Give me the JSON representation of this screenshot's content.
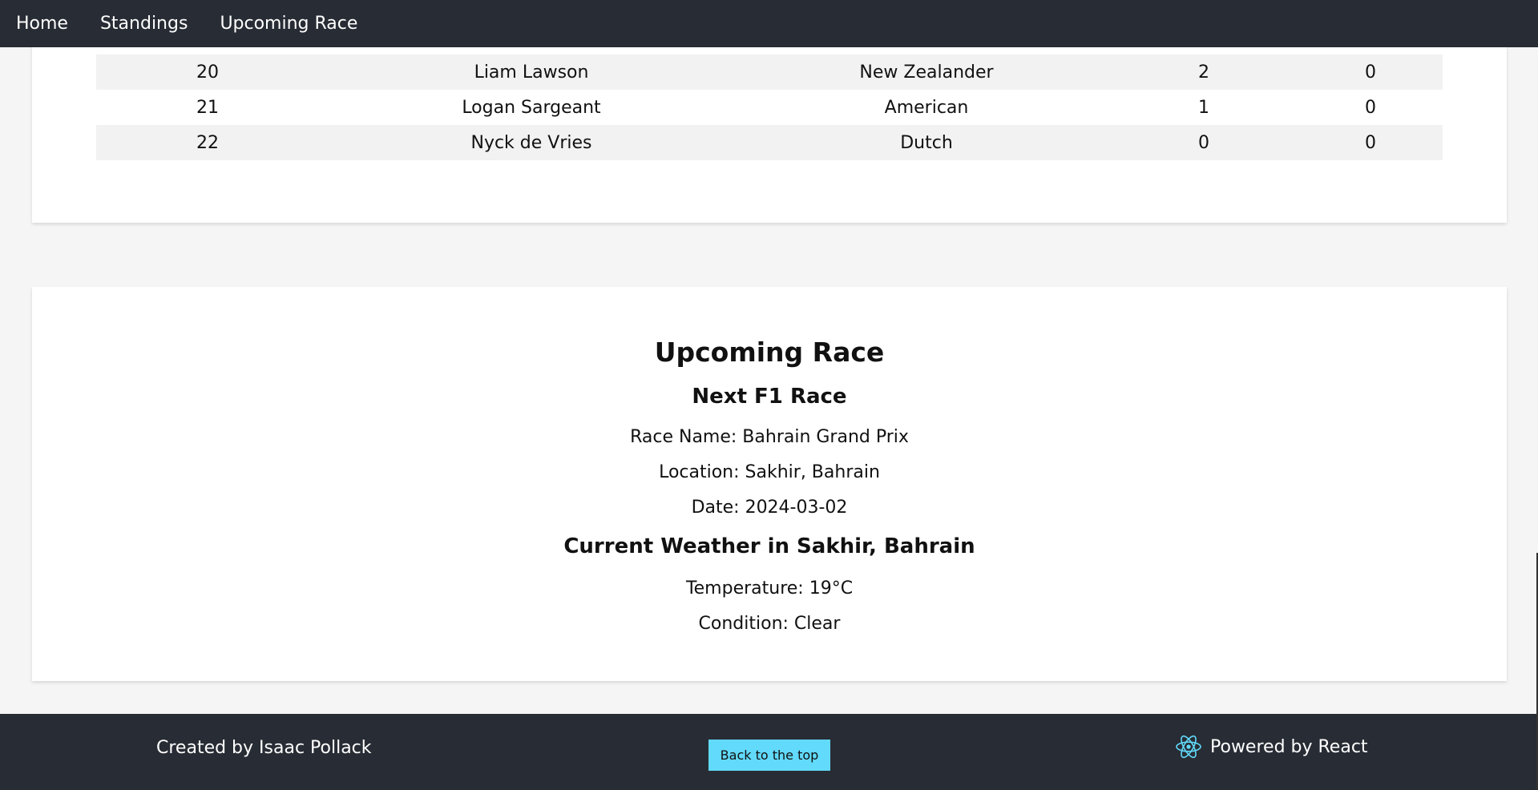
{
  "nav": {
    "links": [
      "Home",
      "Standings",
      "Upcoming Race"
    ]
  },
  "standings": {
    "rows": [
      {
        "pos": "20",
        "name": "Liam Lawson",
        "nationality": "New Zealander",
        "points": "2",
        "wins": "0"
      },
      {
        "pos": "21",
        "name": "Logan Sargeant",
        "nationality": "American",
        "points": "1",
        "wins": "0"
      },
      {
        "pos": "22",
        "name": "Nyck de Vries",
        "nationality": "Dutch",
        "points": "0",
        "wins": "0"
      }
    ]
  },
  "race": {
    "title": "Upcoming Race",
    "subtitle": "Next F1 Race",
    "name_line": "Race Name: Bahrain Grand Prix",
    "location_line": "Location: Sakhir, Bahrain",
    "date_line": "Date: 2024-03-02",
    "weather_title": "Current Weather in Sakhir, Bahrain",
    "temperature_line": "Temperature: 19°C",
    "condition_line": "Condition: Clear"
  },
  "footer": {
    "credit": "Created by Isaac Pollack",
    "back_to_top": "Back to the top",
    "powered_by": "Powered by React",
    "react_icon": "react-logo-icon",
    "accent": "#61dafb"
  },
  "colors": {
    "nav_bg": "#282c34",
    "row_shade": "#f2f2f2"
  }
}
